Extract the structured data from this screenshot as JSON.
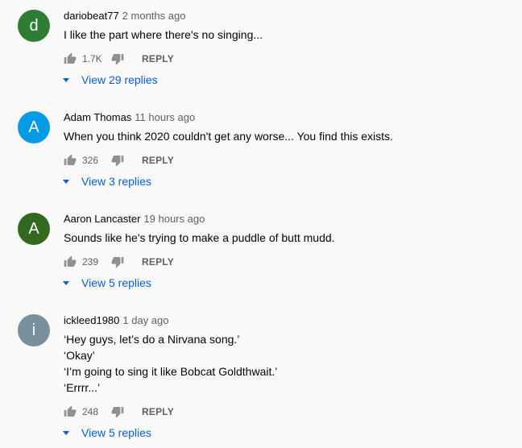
{
  "comments": [
    {
      "author": "dariobeat77",
      "time": "2 months ago",
      "avatar_letter": "d",
      "avatar_color": "#2e7d32",
      "lines": [
        "I like the part where there's no singing..."
      ],
      "likes": "1.7K",
      "reply_label": "REPLY",
      "view_replies": "View 29 replies"
    },
    {
      "author": "Adam Thomas",
      "time": "11 hours ago",
      "avatar_letter": "A",
      "avatar_color": "#039be5",
      "lines": [
        "When you think 2020 couldn't get any worse... You find this exists."
      ],
      "likes": "326",
      "reply_label": "REPLY",
      "view_replies": "View 3 replies"
    },
    {
      "author": "Aaron Lancaster",
      "time": "19 hours ago",
      "avatar_letter": "A",
      "avatar_color": "#33691e",
      "lines": [
        "Sounds like he's trying to make a puddle of butt mudd."
      ],
      "likes": "239",
      "reply_label": "REPLY",
      "view_replies": "View 5 replies"
    },
    {
      "author": "ickleed1980",
      "time": "1 day ago",
      "avatar_letter": "i",
      "avatar_color": "#78909c",
      "lines": [
        "‘Hey guys, let’s do a Nirvana song.’",
        "‘Okay’",
        "‘I’m going to sing it like Bobcat Goldthwait.’",
        "‘Errrr...’"
      ],
      "likes": "248",
      "reply_label": "REPLY",
      "view_replies": "View 5 replies"
    }
  ],
  "icons": {
    "like": "thumb-up-icon",
    "dislike": "thumb-down-icon",
    "expand": "caret-down-icon"
  },
  "colors": {
    "background": "#f9f9f9",
    "link": "#065fd4",
    "secondary_text": "#606060"
  }
}
